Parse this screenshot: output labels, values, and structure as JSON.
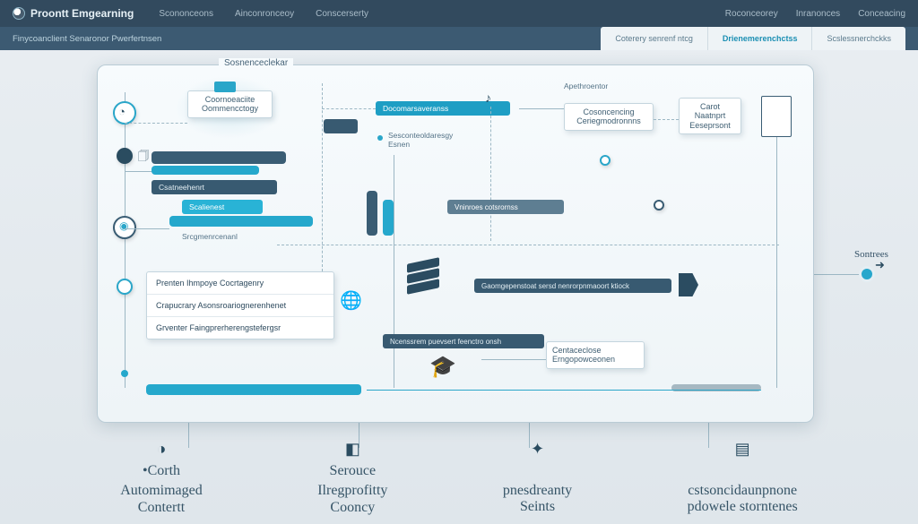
{
  "brand": "Proontt Emgearning",
  "topnav": [
    "Scononceons",
    "Ainconronceoy",
    "Conscerserty"
  ],
  "topright": [
    "Roconceorey",
    "Inranonces",
    "Conceacing"
  ],
  "subbar_title": "Finycoanclient Senaronor Pwerfertnsen",
  "tabs": [
    "Coterery senrenf ntcg",
    "Drienemerenchctss",
    "Scslessnerchckks"
  ],
  "panel_title": "Sosnenceclekar",
  "boxes": {
    "top_left_card": "Coornoeaciite\nOommencctogy",
    "top_mid_pill": "Docomarsaveranss",
    "top_note": "Sesconteoldaresgy\nEsnen",
    "right_card1": "Cosoncencing\nCeriegmodronnns",
    "right_card2": "Carot\nNaatnprt\nEeseprsont",
    "mid_left_pill": "Csatneehenrt",
    "mid_left_tag": "Srcgmenrcenanl",
    "mid_center_bar": "Scalienest",
    "consumers_tag": "Vninroes cotsrornss",
    "list_item1": "Prenten Ihmpoye Cocrtagenry",
    "list_item2": "Crapucrary Asonsroariognerenhenet",
    "list_item3": "Grventer Faingprerherengstefergsr",
    "lower_pill": "Ncenssrem puevsert feenctro onsh",
    "lower_card": "Centaceclose\nErngopowceonen",
    "long_tag": "Gaomgepenstoat sersd nenrorpnmaoort ktiock"
  },
  "side_label_right": "Sontrees",
  "left_col_label": "Apethroentor",
  "categories": [
    {
      "icon": "◑",
      "line1": "•Corth",
      "line2_a": "Automimaged",
      "line2_b": "Contertt"
    },
    {
      "icon": "◧",
      "line1": "Serouce",
      "line2_a": "Ilregprofitty",
      "line2_b": "Cooncy"
    },
    {
      "icon": "✦",
      "line1": "",
      "line2_a": "pnesdreanty",
      "line2_b": "Seints"
    },
    {
      "icon": "▤",
      "line1": "",
      "line2_a": "cstsoncidaunpnone",
      "line2_b": "pdowele storntenes"
    }
  ],
  "colors": {
    "navy": "#324a5e",
    "teal": "#1e9ec4",
    "panel_border": "#b9cbd5"
  }
}
